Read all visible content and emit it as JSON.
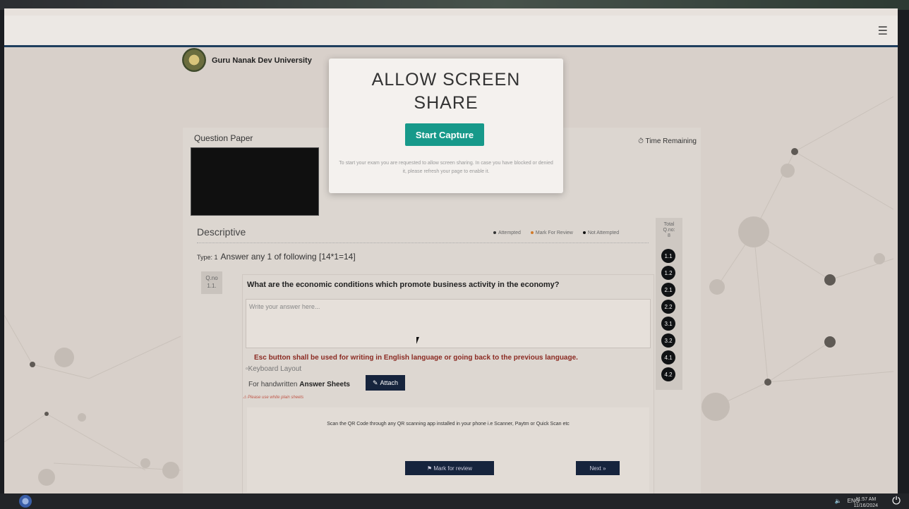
{
  "header": {
    "university": "Guru Nanak Dev University"
  },
  "modal": {
    "title_line1": "ALLOW SCREEN",
    "title_line2": "SHARE",
    "button_label": "Start Capture",
    "message": "To start your exam you are requested to allow screen sharing. In case you have blocked or denied it, please refresh your page to enable it."
  },
  "panel": {
    "title": "Question Paper",
    "time_remaining": "⏱ Time Remaining",
    "section": "Descriptive",
    "legend": {
      "attempted": "Attempted",
      "mark_for_review": "Mark For Review",
      "not_attempted": "Not Attempted"
    },
    "type_label": "Type: 1",
    "type_text": "Answer any 1 of following [14*1=14]",
    "qno_label": "Q.no",
    "qno_value": "1.1.",
    "question": "What are the economic conditions which promote business activity in the economy?",
    "answer_placeholder": "Write your answer here...",
    "esc_notice": "Esc button shall be used for writing in English language or going back to the previous language.",
    "keyboard_alt": "Keyboard Layout",
    "handwritten_prefix": "For handwritten ",
    "handwritten_bold": "Answer Sheets",
    "attach_label": "Attach",
    "note": "Please use white plain sheets",
    "qr_text": "Scan the QR Code through any QR scanning app installed in your phone i.e Scanner, Paytm or Quick Scan etc",
    "mark_review_label": "⚑ Mark for review",
    "next_label": "Next »"
  },
  "total": {
    "line1": "Total",
    "line2": "Q.no:",
    "count": "8"
  },
  "question_numbers": [
    "1.1",
    "1.2",
    "2.1",
    "2.2",
    "3.1",
    "3.2",
    "4.1",
    "4.2"
  ],
  "taskbar": {
    "lang": "ENG",
    "time": "11:57 AM",
    "date": "11/16/2024"
  },
  "colors": {
    "accent": "#17998a",
    "dark_button": "#16243d",
    "warning_text": "#8b2a22"
  }
}
